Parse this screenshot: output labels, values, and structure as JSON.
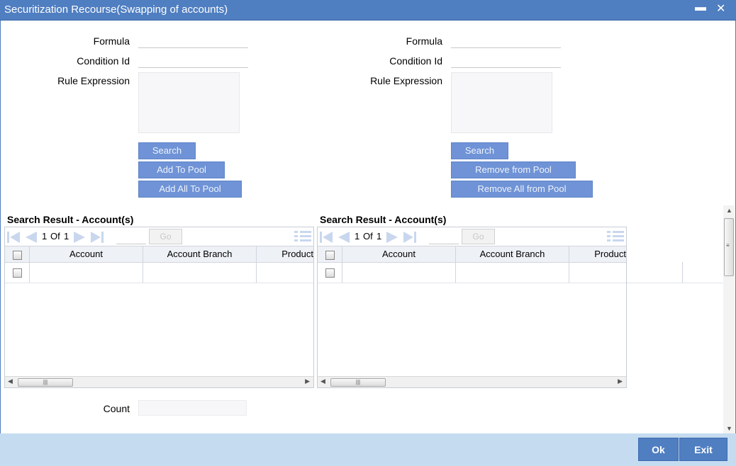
{
  "window": {
    "title": "Securitization Recourse(Swapping of accounts)",
    "minimize_glyph": "▬",
    "close_glyph": "✕"
  },
  "left_form": {
    "formula_label": "Formula",
    "formula_value": "",
    "condition_label": "Condition Id",
    "condition_value": "",
    "rule_label": "Rule Expression",
    "rule_value": "",
    "search_button": "Search",
    "add_button": "Add To Pool",
    "add_all_button": "Add All To Pool"
  },
  "right_form": {
    "formula_label": "Formula",
    "formula_value": "",
    "condition_label": "Condition Id",
    "condition_value": "",
    "rule_label": "Rule Expression",
    "rule_value": "",
    "search_button": "Search",
    "remove_button": "Remove from Pool",
    "remove_all_button": "Remove All from Pool"
  },
  "left_grid": {
    "title": "Search Result - Account(s)",
    "page_current": "1",
    "page_of": "Of",
    "page_total": "1",
    "go_label": "Go",
    "columns": [
      "Account",
      "Account Branch",
      "Product"
    ]
  },
  "right_grid": {
    "title": "Search Result - Account(s)",
    "page_current": "1",
    "page_of": "Of",
    "page_total": "1",
    "go_label": "Go",
    "columns": [
      "Account",
      "Account Branch",
      "Product"
    ]
  },
  "count": {
    "label": "Count",
    "value": ""
  },
  "footer": {
    "ok_label": "Ok",
    "exit_label": "Exit"
  },
  "colors": {
    "title_bar": "#4f7ec1",
    "button": "#6f93d6",
    "footer": "#c5dcf0"
  },
  "icons": [
    "first-page-icon",
    "prev-page-icon",
    "next-page-icon",
    "last-page-icon",
    "columns-icon",
    "minimize-icon",
    "close-icon"
  ]
}
